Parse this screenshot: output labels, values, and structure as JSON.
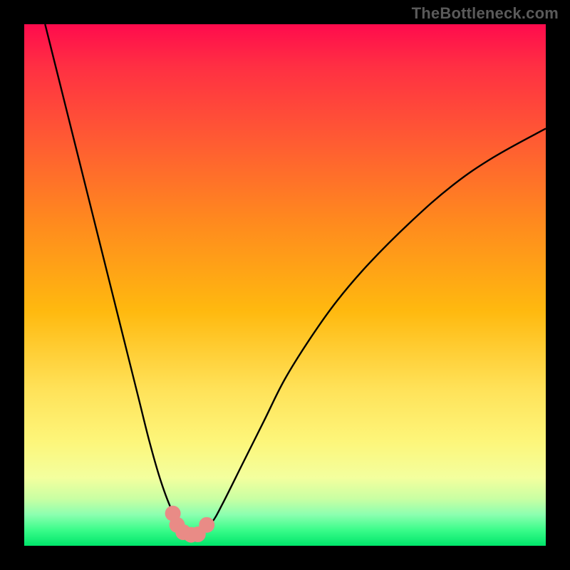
{
  "watermark": {
    "text": "TheBottleneck.com"
  },
  "colors": {
    "curve_stroke": "#000000",
    "marker_fill": "#e98b86",
    "marker_stroke": "#e98b86",
    "background_black": "#000000"
  },
  "chart_data": {
    "type": "line",
    "title": "",
    "xlabel": "",
    "ylabel": "",
    "xlim": [
      0,
      100
    ],
    "ylim": [
      0,
      100
    ],
    "grid": false,
    "series": [
      {
        "name": "bottleneck-curve",
        "x": [
          4,
          6,
          8,
          10,
          12,
          14,
          16,
          18,
          20,
          22,
          24,
          26,
          28,
          30,
          31,
          32,
          33,
          34,
          36,
          38,
          42,
          46,
          50,
          55,
          60,
          66,
          74,
          82,
          90,
          100
        ],
        "y": [
          100,
          92,
          84,
          76,
          68,
          60,
          52,
          44,
          36,
          28,
          20,
          13,
          7.5,
          3.7,
          2.5,
          2.0,
          2.0,
          2.6,
          4.5,
          8,
          16,
          24,
          32,
          40,
          47,
          54,
          62,
          69,
          74.5,
          80
        ]
      }
    ],
    "markers": [
      {
        "x": 28.5,
        "y": 6.2
      },
      {
        "x": 29.3,
        "y": 4.0
      },
      {
        "x": 30.5,
        "y": 2.6
      },
      {
        "x": 32.0,
        "y": 2.1
      },
      {
        "x": 33.3,
        "y": 2.2
      },
      {
        "x": 35.0,
        "y": 4.0
      }
    ],
    "annotations": []
  }
}
